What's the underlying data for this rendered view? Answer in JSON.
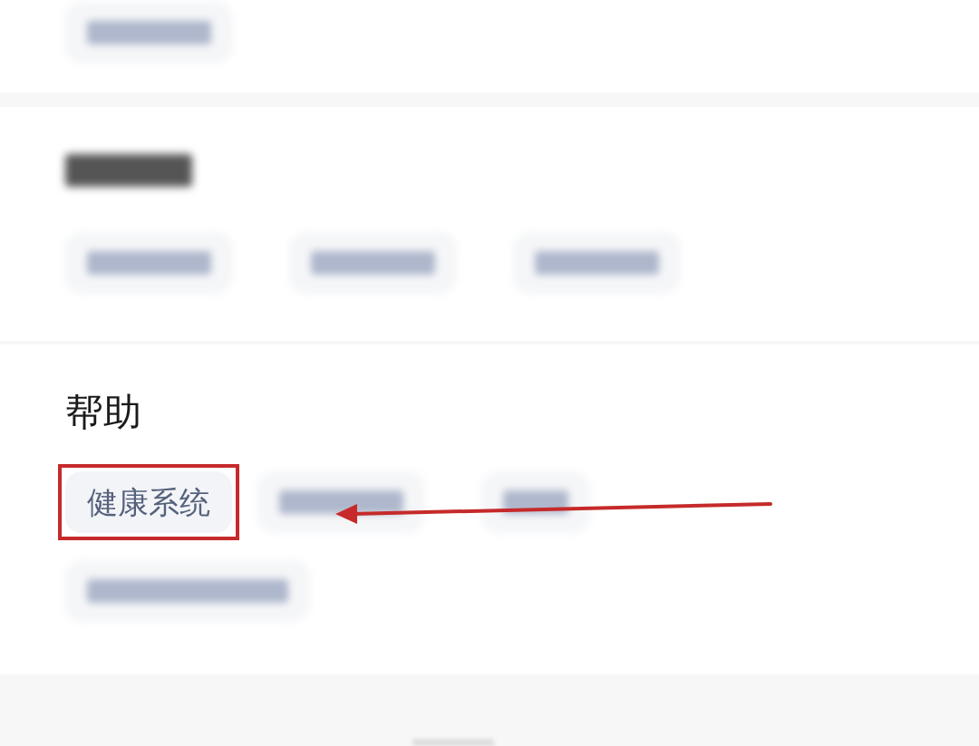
{
  "sections": [
    {
      "chips": [
        {
          "kind": "blurred"
        }
      ]
    },
    {
      "heading": {
        "kind": "blurred"
      },
      "chips": [
        {
          "kind": "blurred"
        },
        {
          "kind": "blurred"
        },
        {
          "kind": "blurred"
        }
      ]
    },
    {
      "heading": {
        "kind": "text",
        "label": "帮助"
      },
      "chips": [
        {
          "kind": "text",
          "label": "健康系统",
          "highlighted": true
        },
        {
          "kind": "blurred"
        },
        {
          "kind": "blurred"
        },
        {
          "kind": "blurred"
        }
      ]
    }
  ],
  "annotation": {
    "kind": "arrow"
  }
}
